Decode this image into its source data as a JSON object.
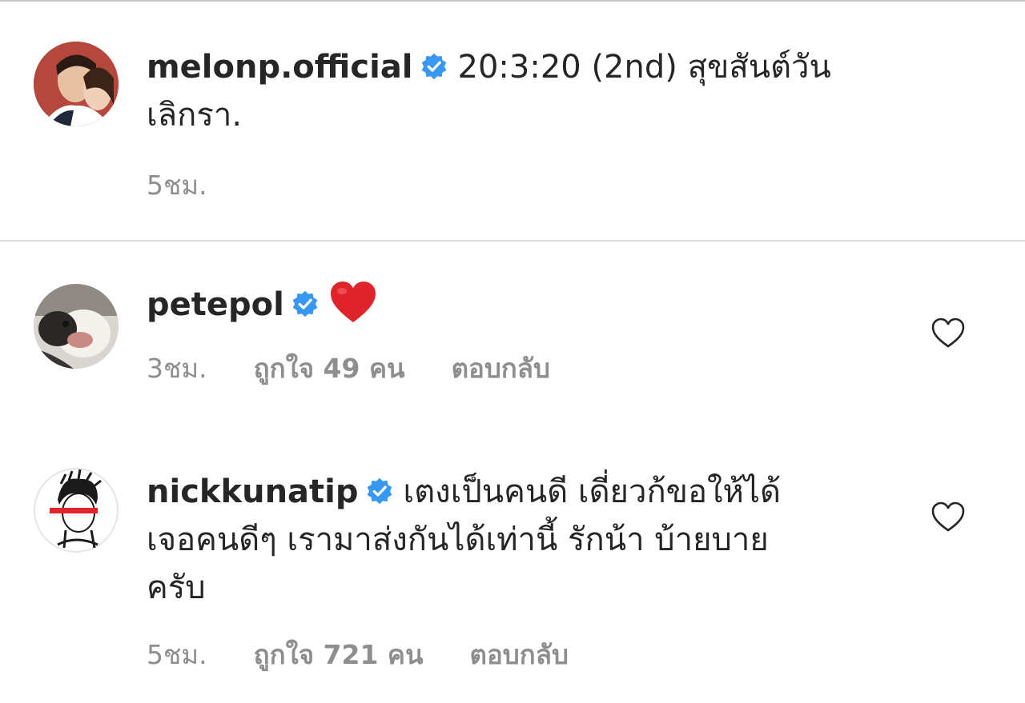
{
  "caption": {
    "username": "melonp.official",
    "text_line1": "20:3:20 (2nd) สุขสันต์วัน",
    "text_line2": "เลิกรา.",
    "time": "5ชม."
  },
  "comments": [
    {
      "username": "petepol",
      "text": "❤️",
      "time": "3ชม.",
      "likes": "ถูกใจ 49 คน",
      "reply": "ตอบกลับ"
    },
    {
      "username": "nickkunatip",
      "text_line1": "เตงเป็นคนดี เดี่ยวก้ขอให้ได้",
      "text_line2": "เจอคนดีๆ เรามาส่งกันได้เท่านี้ รักน้า บ้ายบาย",
      "text_line3": "ครับ",
      "time": "5ชม.",
      "likes": "ถูกใจ 721 คน",
      "reply": "ตอบกลับ"
    }
  ],
  "colors": {
    "text": "#262626",
    "secondary": "#8e8e8e",
    "verified_blue": "#3897f0",
    "heart_red": "#e0242b",
    "divider": "#dbdbdb"
  },
  "icons": {
    "verified": "verified-badge-icon",
    "like": "heart-outline-icon",
    "emoji": "red-heart-emoji"
  }
}
